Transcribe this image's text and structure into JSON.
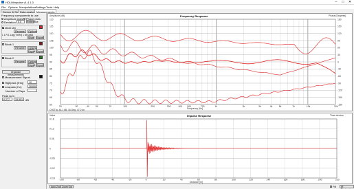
{
  "window": {
    "title": "HOLMImpulse v1.4.1.0",
    "min": "–",
    "max": "□",
    "close": "✕"
  },
  "menu": [
    "File",
    "Options",
    "Manipulations",
    "Settings",
    "Tools",
    "Help"
  ],
  "tabs": [
    "Device & Signal",
    "Data analysis",
    "Measurements"
  ],
  "sidebar": {
    "components_label": "Frequency components to use",
    "amplitude_label": "Amplitude plots",
    "phase_label": "Phase plots",
    "deviation_label": "Deviation",
    "deviation_value": "0.0",
    "ref_label": "Reference",
    "measurements": [
      {
        "name": "Ideal sim",
        "buttons": [
          "Rename",
          "Options"
        ],
        "info": "L 1 R 1 Log [Tx/Rx] 1 MI 0000",
        "actions": [
          "Show",
          "Export"
        ],
        "color": "#e02020"
      },
      {
        "name": "Block 1",
        "buttons": [
          "Rename",
          "Options"
        ],
        "info": "",
        "actions": [
          "Export",
          "Export"
        ],
        "color": "#8b1a1a"
      },
      {
        "name": "Block 2",
        "buttons": [
          "Rename",
          "Options"
        ],
        "info": "",
        "actions": [
          "Export",
          "Export"
        ],
        "color": "#2a7a2a"
      }
    ],
    "organize_label": "Organize measurements",
    "signal_label": "Measurement Signal",
    "highpass_label": "Highpass (freq)",
    "highpass_value": "10",
    "lowpass_label": "Lowpass (Hz)",
    "lowpass_value": "20000",
    "taps_label": "Number of Taps",
    "taps_value": "",
    "peak_label": "Peak sum",
    "peak_from": "0.277",
    "peak_to": "15.501",
    "peak_unit": "dB"
  },
  "freq_plot": {
    "title": "Frequency Response",
    "y_left_label": "Amplitude [dB]",
    "y_right_label": "Phase [Degrees]",
    "x_label": "Frequency [Hz]",
    "footer": "CH1Tra. 44.1 kB, 16 Deg, 47.0 kn",
    "x_ticks": [
      "20",
      "30",
      "40",
      "50",
      "70",
      "100",
      "200",
      "300",
      "400",
      "500",
      "700",
      "1k",
      "2k",
      "3k",
      "4k",
      "5k",
      "7k",
      "10k",
      "20k"
    ],
    "y_right_ticks": [
      "180",
      "150",
      "120",
      "90",
      "60",
      "30",
      "0",
      "-30",
      "-60",
      "-90",
      "-120",
      "-150",
      "-180"
    ],
    "y_left_ticks": [
      "120",
      "115",
      "110",
      "105",
      "100",
      "95",
      "90",
      "85",
      "80",
      "75",
      "70",
      "65",
      "60"
    ]
  },
  "imp_plot": {
    "title": "Impulse Response",
    "y_label": "Value",
    "y_right_label": "Time window",
    "x_label": "Distance [m]",
    "x_ticks": [
      "-100",
      "-80",
      "-60",
      "-40",
      "-20",
      "0",
      "20",
      "40",
      "60",
      "80",
      "100",
      "120",
      "140",
      "160",
      "180",
      "200",
      "220"
    ],
    "y_ticks": [
      "0.18",
      "0.12",
      "0.06",
      "0",
      "-0.06",
      "-0.12",
      "-0.18"
    ],
    "auto_zoom": "Auto Zoom",
    "zoom_out": "Zoom Out",
    "fill": "Fill",
    "window_label": "IR Rectangle"
  },
  "colors": {
    "trace": "#e02020",
    "grid": "#d8d8d8",
    "grid_major": "#b8b8b8"
  }
}
